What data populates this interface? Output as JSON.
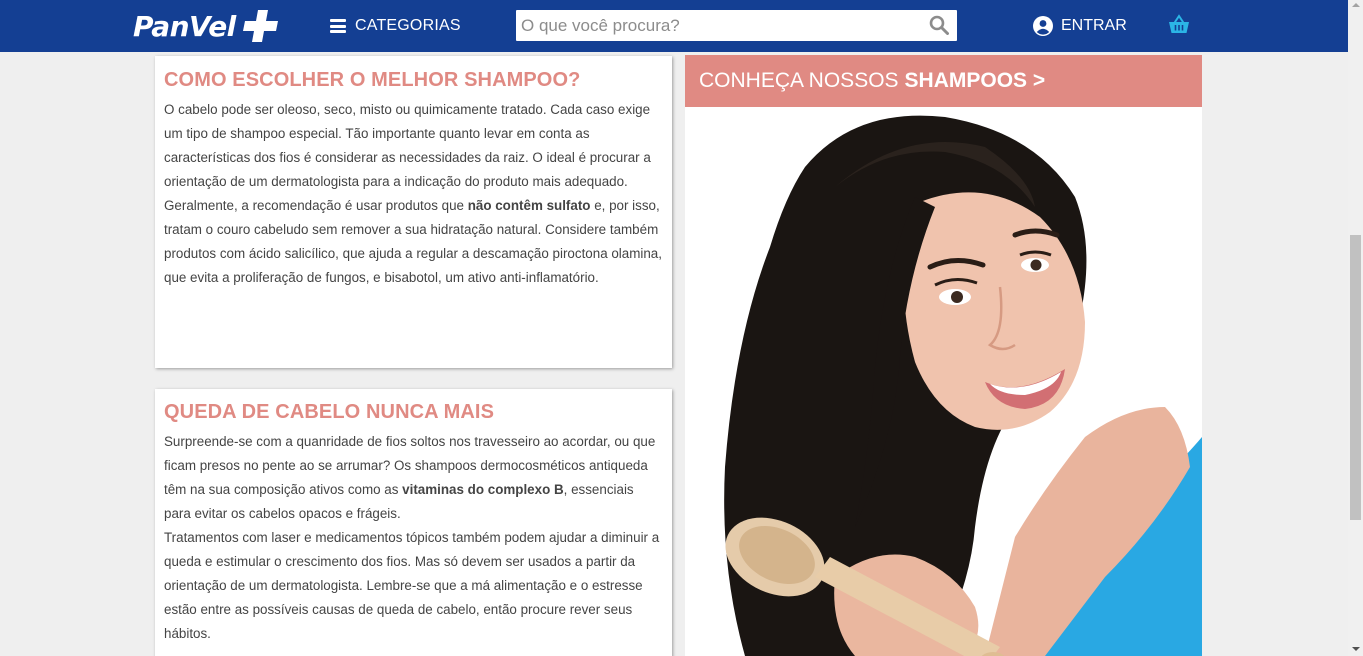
{
  "header": {
    "logo_text": "PanVel",
    "categories_label": "CATEGORIAS",
    "search_placeholder": "O que você procura?",
    "login_label": "ENTRAR",
    "icons": [
      "menu-icon",
      "search-icon",
      "user-icon",
      "basket-icon"
    ],
    "bg_color": "#143f93"
  },
  "card1": {
    "title": "COMO ESCOLHER O MELHOR SHAMPOO?",
    "text_before": "O cabelo pode ser oleoso, seco, misto ou quimicamente tratado. Cada caso exige um tipo de shampoo especial. Tão importante quanto levar em conta as características dos fios é considerar as necessidades da raiz. O ideal é procurar a orientação de um dermatologista para a indicação do produto mais adequado. Geralmente, a recomendação é usar produtos que ",
    "text_bold": "não contêm sulfato",
    "text_after": " e, por isso, tratam o couro cabeludo sem remover a sua hidratação natural. Considere também produtos com ácido salicílico, que ajuda a regular a descamação piroctona olamina, que evita a proliferação de fungos, e bisabotol, um ativo anti-inflamatório."
  },
  "card2": {
    "title": "QUEDA DE CABELO NUNCA MAIS",
    "p1_before": "Surpreende-se com a quanridade de fios soltos nos travesseiro ao acordar, ou que ficam presos no pente ao se arrumar? Os shampoos dermocosméticos antiqueda têm na sua composição ativos como as ",
    "p1_bold": "vitaminas do complexo B",
    "p1_after": ", essenciais para evitar os cabelos opacos e frágeis.",
    "p2": "Tratamentos com laser e medicamentos tópicos também podem ajudar a diminuir a queda e estimular o crescimento dos fios. Mas só devem ser usados a partir da orientação de um dermatologista. Lembre-se que a má alimentação e o estresse estão entre as possíveis causas de queda de cabelo, então procure rever seus hábitos."
  },
  "banner": {
    "prefix": "CONHEÇA NOSSOS",
    "bold": "SHAMPOOS >",
    "accent_color": "#e08a83"
  }
}
